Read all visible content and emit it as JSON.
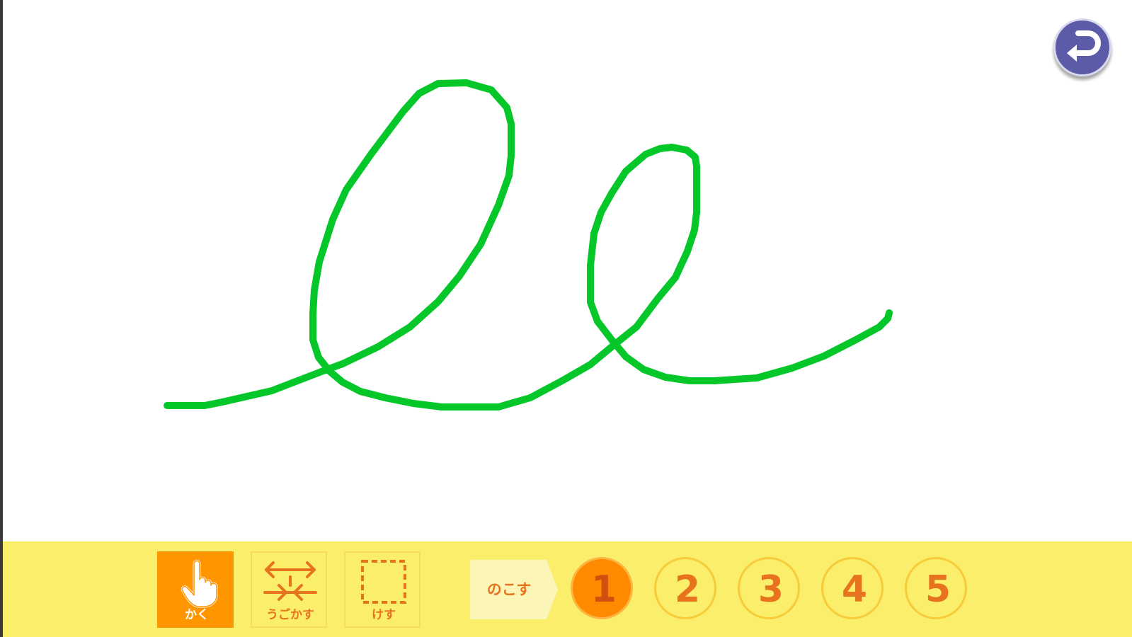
{
  "canvas": {
    "stroke_color": "#06c72a",
    "stroke_width": 10
  },
  "header": {
    "back_icon": "return-arrow-icon"
  },
  "toolbar": {
    "tools": [
      {
        "label": "かく",
        "icon": "pointing-hand-icon",
        "active": true
      },
      {
        "label": "うごかす",
        "icon": "move-arrows-icon",
        "active": false
      },
      {
        "label": "けす",
        "icon": "dashed-square-icon",
        "active": false
      }
    ],
    "keep_label": "のこす",
    "slots": [
      {
        "label": "1",
        "active": true
      },
      {
        "label": "2",
        "active": false
      },
      {
        "label": "3",
        "active": false
      },
      {
        "label": "4",
        "active": false
      },
      {
        "label": "5",
        "active": false
      }
    ]
  },
  "colors": {
    "toolbar_bg": "#fbee6a",
    "accent_orange": "#ff9600",
    "text_orange": "#e8731e",
    "back_button": "#5b5ba8"
  }
}
